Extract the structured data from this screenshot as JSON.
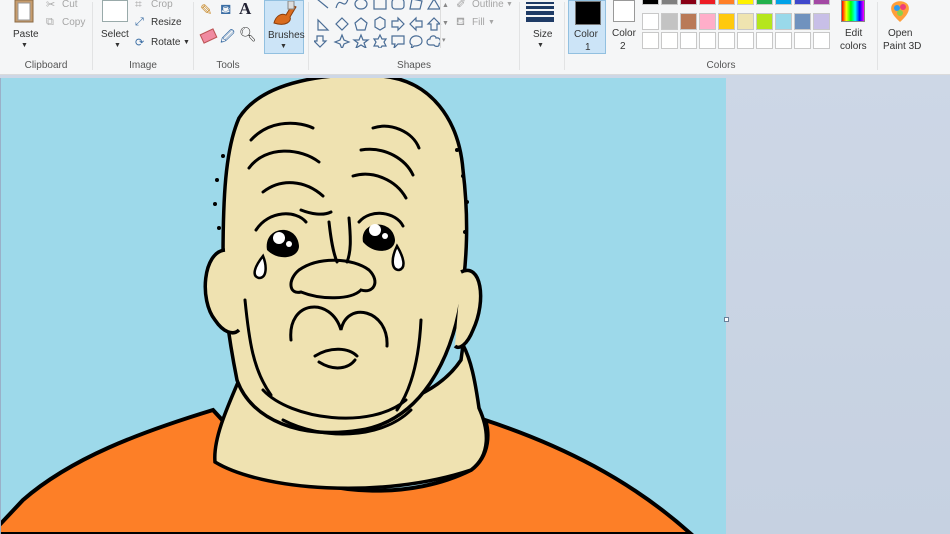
{
  "clipboard": {
    "paste": "Paste",
    "cut": "Cut",
    "copy": "Copy",
    "label": "Clipboard"
  },
  "image": {
    "select": "Select",
    "crop": "Crop",
    "resize": "Resize",
    "rotate": "Rotate",
    "label": "Image"
  },
  "tools": {
    "label": "Tools",
    "brushes": "Brushes"
  },
  "shapes": {
    "outline": "Outline",
    "fill": "Fill",
    "label": "Shapes"
  },
  "size": {
    "label": "Size"
  },
  "colors": {
    "color1_line1": "Color",
    "color1_line2": "1",
    "color2_line1": "Color",
    "color2_line2": "2",
    "edit_line1": "Edit",
    "edit_line2": "colors",
    "label": "Colors",
    "color1_value": "#000000",
    "color2_value": "#ffffff",
    "palette_row1": [
      "#000000",
      "#7f7f7f",
      "#880015",
      "#ed1c24",
      "#ff7f27",
      "#fff200",
      "#22b14c",
      "#00a2e8",
      "#3f48cc",
      "#a349a4"
    ],
    "palette_row2": [
      "#ffffff",
      "#c3c3c3",
      "#b97a57",
      "#ffaec9",
      "#ffc90e",
      "#efe4b0",
      "#b5e61d",
      "#99d9ea",
      "#7092be",
      "#c8bfe7"
    ]
  },
  "paint3d": {
    "line1": "Open",
    "line2": "Paint 3D"
  },
  "artwork": {
    "background": "#9dd9ea",
    "skin": "#efe2b1",
    "shirt": "#fd7f27",
    "outline": "#000000"
  }
}
